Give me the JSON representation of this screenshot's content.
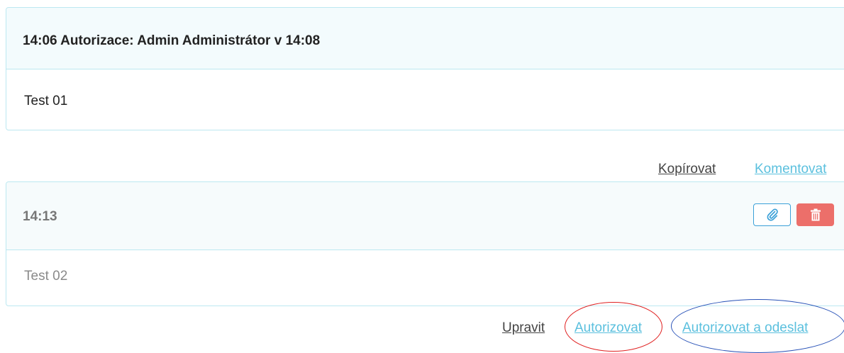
{
  "entries": [
    {
      "header": "14:06 Autorizace: Admin Administrátor v 14:08",
      "body": "Test 01",
      "actions": [
        "Kopírovat",
        "Komentovat"
      ]
    },
    {
      "header": "14:13",
      "body": "Test 02",
      "buttons": {
        "attach_icon": "paperclip-icon",
        "delete_icon": "trash-icon"
      },
      "actions": [
        "Upravit",
        "Autorizovat",
        "Autorizovat a odeslat"
      ]
    }
  ],
  "colors": {
    "border": "#bce8f1",
    "header_bg": "#f3fbfd",
    "link_blue": "#5bc0de",
    "link_dark": "#444444",
    "attach_border": "#3aa0d8",
    "delete_bg": "#ec6f6a",
    "annotation_red": "#e02020",
    "annotation_blue": "#2a53b8"
  }
}
